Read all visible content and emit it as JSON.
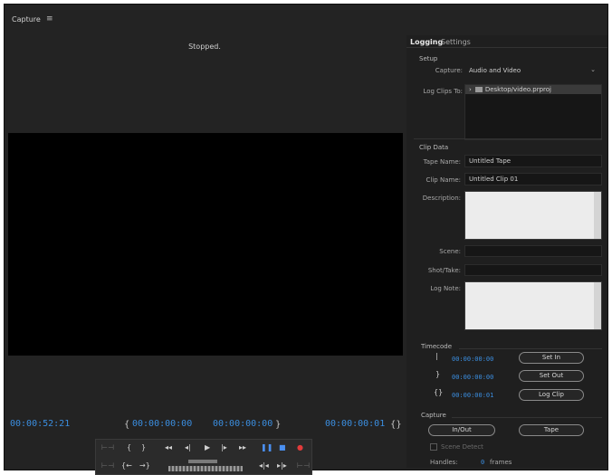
{
  "window": {
    "title": "Capture",
    "menu_icon": "≡"
  },
  "monitor": {
    "status": "Stopped.",
    "current_timecode": "00:00:52:21",
    "in_point": "00:00:00:00",
    "out_point": "00:00:00:00",
    "duration": "00:00:00:01"
  },
  "transport": {
    "mark_in": "{",
    "mark_out": "}",
    "goto_in": "{←",
    "goto_out": "→}",
    "rewind": "◂◂",
    "step_back": "◂|",
    "play": "▶",
    "step_forward": "|▸",
    "fast_forward": "▸▸",
    "pause": "❚❚",
    "stop": "■",
    "record": "●",
    "prev_scene": "◂|◂",
    "next_scene": "▸|▸",
    "extra": "⊢⊣"
  },
  "logging_panel": {
    "tabs": {
      "logging": "Logging",
      "settings": "Settings"
    },
    "setup": {
      "heading": "Setup",
      "capture_label": "Capture:",
      "capture_value": "Audio and Video",
      "log_clips_label": "Log Clips To:",
      "log_clips_value": "Desktop/video.prproj"
    },
    "clip_data": {
      "heading": "Clip Data",
      "tape_name_label": "Tape Name:",
      "tape_name_value": "Untitled Tape",
      "clip_name_label": "Clip Name:",
      "clip_name_value": "Untitled Clip 01",
      "description_label": "Description:",
      "scene_label": "Scene:",
      "shot_take_label": "Shot/Take:",
      "log_note_label": "Log Note:"
    },
    "timecode": {
      "heading": "Timecode",
      "in": "00:00:00:00",
      "out": "00:00:00:00",
      "duration": "00:00:00:01",
      "set_in": "Set In",
      "set_out": "Set Out",
      "log_clip": "Log Clip"
    },
    "capture": {
      "heading": "Capture",
      "in_out": "In/Out",
      "tape": "Tape",
      "scene_detect": "Scene Detect",
      "handles_label": "Handles:",
      "handles_value": "0",
      "handles_unit": "frames"
    }
  }
}
